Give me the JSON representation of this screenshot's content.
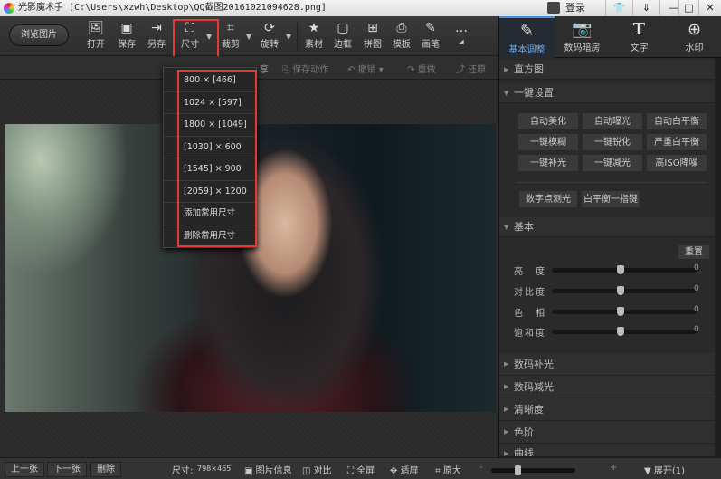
{
  "window": {
    "title": "光影魔术手 [C:\\Users\\xzwh\\Desktop\\QQ截图20161021094628.png]",
    "login": "登录",
    "controls": [
      "shirt-icon",
      "menu-icon",
      "minimize-icon",
      "maximize-icon",
      "close-icon"
    ]
  },
  "toolbar": {
    "browse": "浏览图片",
    "tools": [
      {
        "label": "打开",
        "icon": "open-icon"
      },
      {
        "label": "保存",
        "icon": "save-icon"
      },
      {
        "label": "另存",
        "icon": "save-as-icon"
      },
      {
        "label": "尺寸",
        "icon": "resize-icon"
      },
      {
        "label": "裁剪",
        "icon": "crop-icon"
      },
      {
        "label": "旋转",
        "icon": "rotate-icon"
      },
      {
        "label": "素材",
        "icon": "material-icon"
      },
      {
        "label": "边框",
        "icon": "border-icon"
      },
      {
        "label": "拼图",
        "icon": "collage-icon"
      },
      {
        "label": "模板",
        "icon": "template-icon"
      },
      {
        "label": "画笔",
        "icon": "brush-icon"
      },
      {
        "label": "…",
        "icon": "more-icon"
      }
    ],
    "highlight_color": "#e53935"
  },
  "secondary": {
    "share": "享",
    "save_action": "保存动作",
    "undo": "撤销",
    "redo": "重做",
    "restore": "还原"
  },
  "size_menu": {
    "items": [
      "800 × [466]",
      "1024 × [597]",
      "1800 × [1049]",
      "[1030] × 600",
      "[1545] × 900",
      "[2059] × 1200",
      "添加常用尺寸",
      "删除常用尺寸"
    ]
  },
  "right_panel": {
    "tabs": [
      {
        "label": "基本调整",
        "icon": "edit-icon",
        "active": true
      },
      {
        "label": "数码暗房",
        "icon": "camera-icon"
      },
      {
        "label": "文字",
        "icon": "text-icon"
      },
      {
        "label": "水印",
        "icon": "watermark-icon"
      }
    ],
    "histogram": "直方图",
    "one_click": {
      "title": "一键设置",
      "buttons": [
        "自动美化",
        "自动曝光",
        "自动白平衡",
        "一键模糊",
        "一键锐化",
        "严重白平衡",
        "一键补光",
        "一键减光",
        "高ISO降噪"
      ],
      "extra": [
        "数字点测光",
        "白平衡一指键"
      ]
    },
    "basic": {
      "title": "基本",
      "reset": "重置",
      "sliders": [
        {
          "label": "亮　度",
          "value": 0
        },
        {
          "label": "对比度",
          "value": 0
        },
        {
          "label": "色　相",
          "value": 0
        },
        {
          "label": "饱和度",
          "value": 0
        }
      ]
    },
    "sections": [
      "数码补光",
      "数码减光",
      "清晰度",
      "色阶",
      "曲线"
    ]
  },
  "bottom": {
    "prev": "上一张",
    "next": "下一张",
    "delete": "删除",
    "size_label": "尺寸:",
    "size_value": "798×465",
    "info": "图片信息",
    "compare": "对比",
    "fullscreen": "全屏",
    "fit": "适屏",
    "original": "原大",
    "zoom_minus": "-",
    "zoom_plus": "+",
    "zoom_level": 0.3,
    "expand": "展开(1)"
  }
}
